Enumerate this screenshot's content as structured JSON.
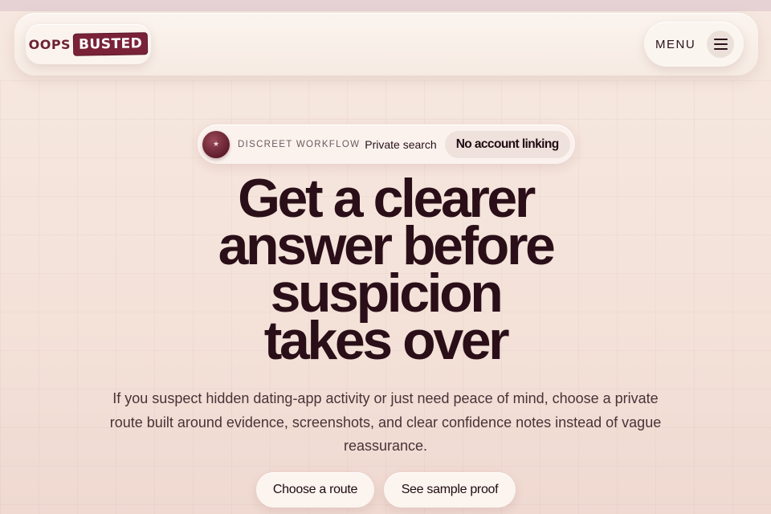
{
  "header": {
    "logo": {
      "part1": "OOPS",
      "part2": "BUSTED"
    },
    "menu_label": "MENU",
    "menu_icon": "hamburger-icon"
  },
  "hero": {
    "pill": {
      "badge_icon": "star-badge-icon",
      "eyebrow": "DISCREET WORKFLOW",
      "private_label": "Private search",
      "chip_label": "No account linking"
    },
    "headline_lines": [
      "Get a clearer",
      "answer before",
      "suspicion",
      "takes over"
    ],
    "subtext": "If you suspect hidden dating-app activity or just need peace of mind, choose a private route built around evidence, screenshots, and clear confidence notes instead of vague reassurance.",
    "cta_primary": "Choose a route",
    "cta_secondary": "See sample proof"
  }
}
